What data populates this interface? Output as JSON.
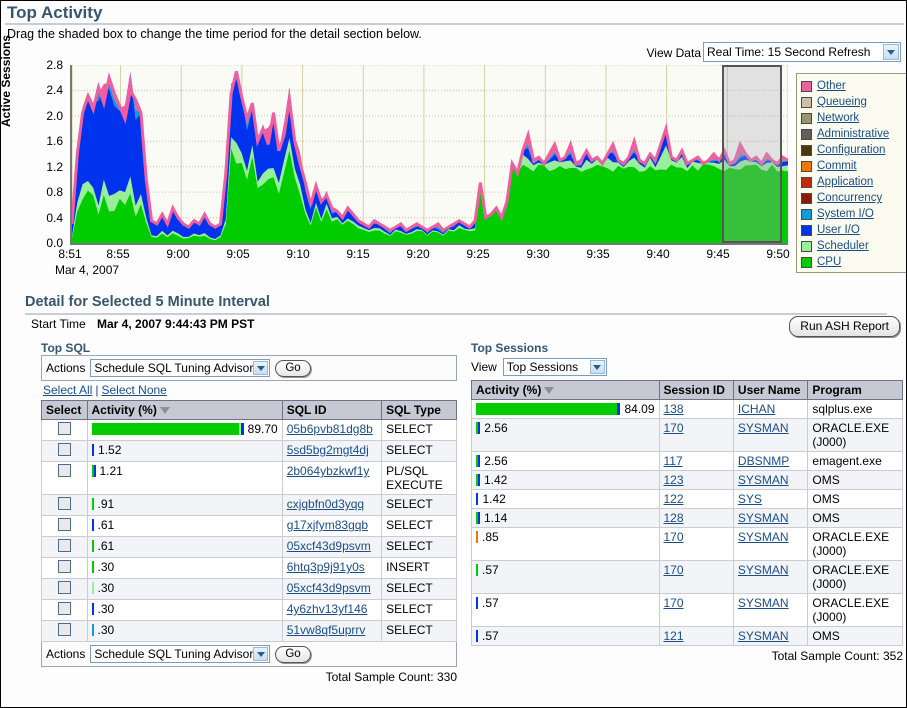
{
  "header": {
    "title": "Top Activity",
    "instruction": "Drag the shaded box to change the time period for the detail section below.",
    "view_data_label": "View Data",
    "view_data_value": "Real Time: 15 Second Refresh"
  },
  "chart_data": {
    "type": "area",
    "title": "Top Activity",
    "xlabel": "",
    "ylabel": "Active Sessions",
    "ylim": [
      0.0,
      2.8
    ],
    "yticks": [
      "0.0",
      "0.4",
      "0.8",
      "1.2",
      "1.6",
      "2.0",
      "2.4",
      "2.8"
    ],
    "xticks": [
      "8:51",
      "8:55",
      "9:00",
      "9:05",
      "9:10",
      "9:15",
      "9:20",
      "9:25",
      "9:30",
      "9:35",
      "9:40",
      "9:45",
      "9:50"
    ],
    "x_axis_date": "Mar 4, 2007",
    "grid": true,
    "legend_position": "right",
    "stacked": true,
    "selection": {
      "from": "9:44:43 PM",
      "interval_minutes": 5
    },
    "series": [
      {
        "name": "CPU",
        "color": "#00cc00"
      },
      {
        "name": "Scheduler",
        "color": "#99ee99"
      },
      {
        "name": "User I/O",
        "color": "#0033ee"
      },
      {
        "name": "System I/O",
        "color": "#1199dd"
      },
      {
        "name": "Concurrency",
        "color": "#8b1a0a"
      },
      {
        "name": "Application",
        "color": "#c02a0a"
      },
      {
        "name": "Commit",
        "color": "#ee7700"
      },
      {
        "name": "Configuration",
        "color": "#4a3a0a"
      },
      {
        "name": "Administrative",
        "color": "#5f5f5f"
      },
      {
        "name": "Network",
        "color": "#9a9470"
      },
      {
        "name": "Queueing",
        "color": "#ccbfa3"
      },
      {
        "name": "Other",
        "color": "#ef5fa0"
      }
    ],
    "samples": {
      "comment": "Total active sessions sampled across the window (top-of-stack value), 0.0-2.8 range",
      "total": [
        0.3,
        1.4,
        2.05,
        2.3,
        2.1,
        2.45,
        2.2,
        2.6,
        2.35,
        2.15,
        1.95,
        2.4,
        2.25,
        2.05,
        1.0,
        0.35,
        0.3,
        0.45,
        0.3,
        0.55,
        0.4,
        0.3,
        0.25,
        0.35,
        0.3,
        0.45,
        0.3,
        0.25,
        0.3,
        1.1,
        2.35,
        2.7,
        2.3,
        1.95,
        2.2,
        1.6,
        1.8,
        1.55,
        2.05,
        1.45,
        1.7,
        2.25,
        1.6,
        1.25,
        0.95,
        0.6,
        0.9,
        0.65,
        0.75,
        0.55,
        0.5,
        0.4,
        0.55,
        0.45,
        0.35,
        0.3,
        0.25,
        0.35,
        0.3,
        0.25,
        0.2,
        0.25,
        0.3,
        0.2,
        0.25,
        0.3,
        0.25,
        0.2,
        0.25,
        0.3,
        0.2,
        0.25,
        0.3,
        0.35,
        0.3,
        0.25,
        0.35,
        0.95,
        0.4,
        0.45,
        0.55,
        0.4,
        0.65,
        1.25,
        1.1,
        1.45,
        1.7,
        1.3,
        1.35,
        1.25,
        1.4,
        1.55,
        1.3,
        1.35,
        1.55,
        1.25,
        1.3,
        1.45,
        1.3,
        1.35,
        1.25,
        1.4,
        1.55,
        1.3,
        1.25,
        1.35,
        1.6,
        1.3,
        1.25,
        1.4,
        1.3,
        1.55,
        1.8,
        1.35,
        1.3,
        1.45,
        1.25,
        1.3,
        1.35,
        1.25,
        1.3,
        1.4,
        1.3,
        1.45,
        1.25,
        1.3,
        1.55,
        1.4,
        1.3,
        1.35,
        1.25,
        1.4,
        1.3,
        1.25,
        1.35,
        1.3
      ]
    }
  },
  "legend": {
    "items": [
      {
        "label": "Other",
        "color": "#ef5fa0"
      },
      {
        "label": "Queueing",
        "color": "#ccbfa3"
      },
      {
        "label": "Network",
        "color": "#9a9470"
      },
      {
        "label": "Administrative",
        "color": "#5f5f5f"
      },
      {
        "label": "Configuration",
        "color": "#4a3a0a"
      },
      {
        "label": "Commit",
        "color": "#ee7700"
      },
      {
        "label": "Application",
        "color": "#c02a0a"
      },
      {
        "label": "Concurrency",
        "color": "#8b1a0a"
      },
      {
        "label": "System I/O",
        "color": "#1199dd"
      },
      {
        "label": "User I/O",
        "color": "#0033ee"
      },
      {
        "label": "Scheduler",
        "color": "#99ee99"
      },
      {
        "label": "CPU",
        "color": "#00cc00"
      }
    ]
  },
  "detail": {
    "section_title": "Detail for Selected 5 Minute Interval",
    "start_time_label": "Start Time",
    "start_time_value": "Mar 4, 2007 9:44:43 PM PST",
    "run_ash_report": "Run ASH Report"
  },
  "top_sql": {
    "panel_title": "Top SQL",
    "actions_label": "Actions",
    "actions_value": "Schedule SQL Tuning Advisor",
    "go_label": "Go",
    "select_all": "Select All",
    "select_none": "Select None",
    "columns": [
      "Select",
      "Activity (%)",
      "SQL ID",
      "SQL Type"
    ],
    "total_label": "Total Sample Count: 330",
    "rows": [
      {
        "activity": "89.70",
        "pct": 89.7,
        "sql_id": "05b6pvb81dg8b",
        "sql_type": "SELECT",
        "bar": [
          {
            "color": "#00cc00",
            "w": 88.0
          },
          {
            "color": "#99ee99",
            "w": 1.0
          },
          {
            "color": "#0033ee",
            "w": 1.4
          }
        ]
      },
      {
        "activity": "1.52",
        "pct": 1.52,
        "sql_id": "5sd5bg2mgt4dj",
        "sql_type": "SELECT",
        "bar": [
          {
            "color": "#0033ee",
            "w": 1.52
          }
        ]
      },
      {
        "activity": "1.21",
        "pct": 1.21,
        "sql_id": "2b064ybzkwf1y",
        "sql_type": "PL/SQL EXECUTE",
        "bar": [
          {
            "color": "#00cc00",
            "w": 0.7
          },
          {
            "color": "#0033ee",
            "w": 0.6
          }
        ]
      },
      {
        "activity": ".91",
        "pct": 0.91,
        "sql_id": "cxjqbfn0d3yqq",
        "sql_type": "SELECT",
        "bar": [
          {
            "color": "#00cc00",
            "w": 0.91
          }
        ]
      },
      {
        "activity": ".61",
        "pct": 0.61,
        "sql_id": "g17xjfym83gqb",
        "sql_type": "SELECT",
        "bar": [
          {
            "color": "#0033ee",
            "w": 0.61
          }
        ]
      },
      {
        "activity": ".61",
        "pct": 0.61,
        "sql_id": "05xcf43d9psvm",
        "sql_type": "SELECT",
        "bar": [
          {
            "color": "#00cc00",
            "w": 0.61
          }
        ]
      },
      {
        "activity": ".30",
        "pct": 0.3,
        "sql_id": "6htq3p9j91y0s",
        "sql_type": "INSERT",
        "bar": [
          {
            "color": "#00cc00",
            "w": 0.3
          }
        ]
      },
      {
        "activity": ".30",
        "pct": 0.3,
        "sql_id": "05xcf43d9psvm",
        "sql_type": "SELECT",
        "bar": [
          {
            "color": "#99ee99",
            "w": 0.3
          }
        ]
      },
      {
        "activity": ".30",
        "pct": 0.3,
        "sql_id": "4y6zhv13yf146",
        "sql_type": "SELECT",
        "bar": [
          {
            "color": "#0033ee",
            "w": 0.3
          }
        ]
      },
      {
        "activity": ".30",
        "pct": 0.3,
        "sql_id": "51vw8qf5uprrv",
        "sql_type": "SELECT",
        "bar": [
          {
            "color": "#1199dd",
            "w": 0.3
          }
        ]
      }
    ]
  },
  "top_sessions": {
    "panel_title": "Top Sessions",
    "view_label": "View",
    "view_value": "Top Sessions",
    "columns": [
      "Activity (%)",
      "Session ID",
      "User Name",
      "Program"
    ],
    "total_label": "Total Sample Count: 352",
    "rows": [
      {
        "activity": "84.09",
        "pct": 84.09,
        "session_id": "138",
        "user_name": "ICHAN",
        "program": "sqlplus.exe",
        "bar": [
          {
            "color": "#00cc00",
            "w": 82.0
          },
          {
            "color": "#0033ee",
            "w": 2.0
          }
        ]
      },
      {
        "activity": "2.56",
        "pct": 2.56,
        "session_id": "170",
        "user_name": "SYSMAN",
        "program": "ORACLE.EXE (J000)",
        "bar": [
          {
            "color": "#00cc00",
            "w": 1.3
          },
          {
            "color": "#0033ee",
            "w": 1.2
          }
        ]
      },
      {
        "activity": "2.56",
        "pct": 2.56,
        "session_id": "117",
        "user_name": "DBSNMP",
        "program": "emagent.exe",
        "bar": [
          {
            "color": "#00cc00",
            "w": 1.3
          },
          {
            "color": "#0033ee",
            "w": 1.2
          }
        ]
      },
      {
        "activity": "1.42",
        "pct": 1.42,
        "session_id": "123",
        "user_name": "SYSMAN",
        "program": "OMS",
        "bar": [
          {
            "color": "#00cc00",
            "w": 0.8
          },
          {
            "color": "#0033ee",
            "w": 0.6
          }
        ]
      },
      {
        "activity": "1.42",
        "pct": 1.42,
        "session_id": "122",
        "user_name": "SYS",
        "program": "OMS",
        "bar": [
          {
            "color": "#0033ee",
            "w": 1.42
          }
        ]
      },
      {
        "activity": "1.14",
        "pct": 1.14,
        "session_id": "128",
        "user_name": "SYSMAN",
        "program": "OMS",
        "bar": [
          {
            "color": "#00cc00",
            "w": 0.6
          },
          {
            "color": "#0033ee",
            "w": 0.54
          }
        ]
      },
      {
        "activity": ".85",
        "pct": 0.85,
        "session_id": "170",
        "user_name": "SYSMAN",
        "program": "ORACLE.EXE (J000)",
        "bar": [
          {
            "color": "#ee7700",
            "w": 0.85
          }
        ]
      },
      {
        "activity": ".57",
        "pct": 0.57,
        "session_id": "170",
        "user_name": "SYSMAN",
        "program": "ORACLE.EXE (J000)",
        "bar": [
          {
            "color": "#00cc00",
            "w": 0.57
          }
        ]
      },
      {
        "activity": ".57",
        "pct": 0.57,
        "session_id": "170",
        "user_name": "SYSMAN",
        "program": "ORACLE.EXE (J000)",
        "bar": [
          {
            "color": "#0033ee",
            "w": 0.57
          }
        ]
      },
      {
        "activity": ".57",
        "pct": 0.57,
        "session_id": "121",
        "user_name": "SYSMAN",
        "program": "OMS",
        "bar": [
          {
            "color": "#0033ee",
            "w": 0.57
          }
        ]
      }
    ]
  }
}
